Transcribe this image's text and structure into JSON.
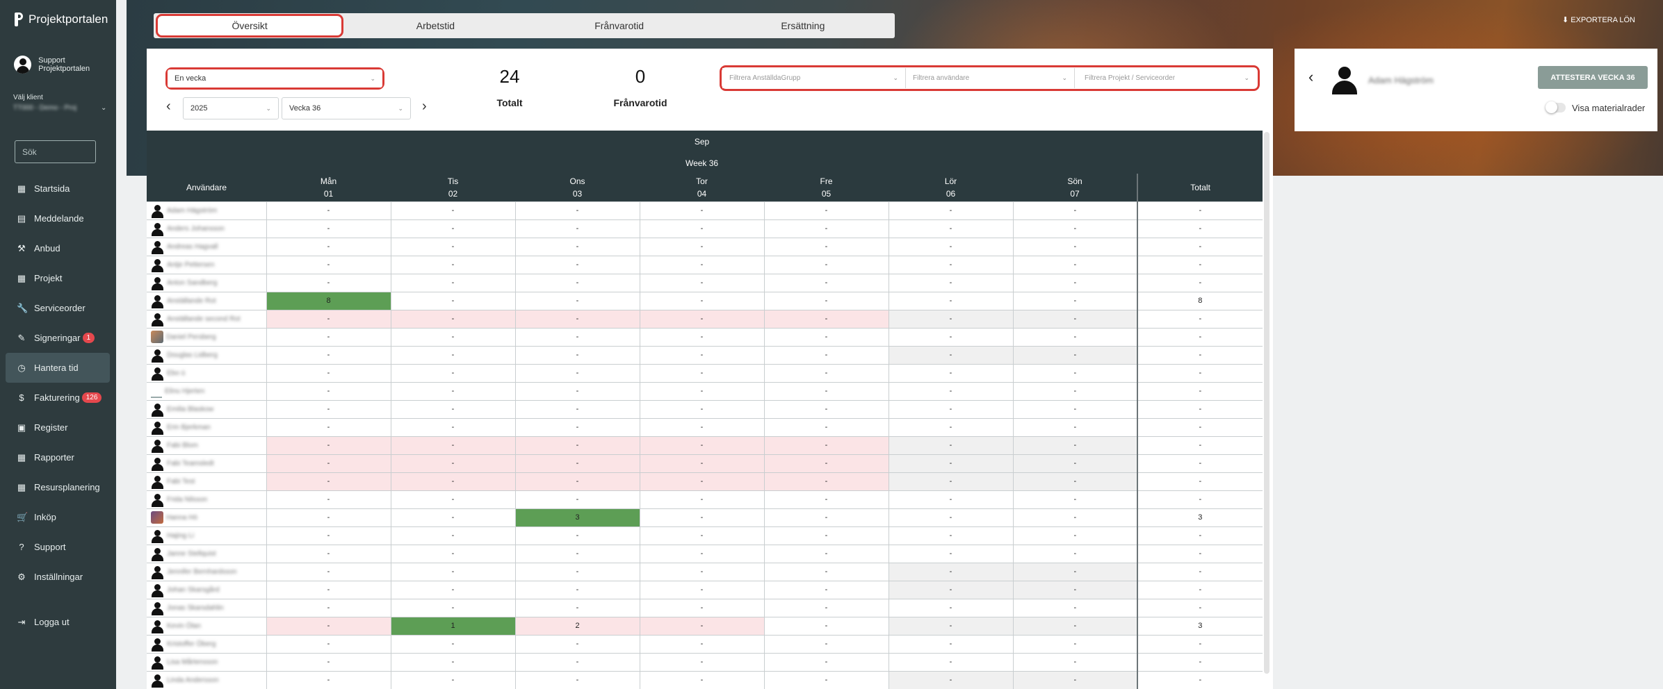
{
  "app": {
    "name": "Projektportalen"
  },
  "sidebar": {
    "user_name": "Support Projektportalen",
    "client_label": "Välj klient",
    "client_value": "TT000 - Demo - Proj",
    "search_placeholder": "Sök",
    "items": [
      {
        "label": "Startsida",
        "icon": "grid-icon",
        "glyph": "▦"
      },
      {
        "label": "Meddelande",
        "icon": "message-icon",
        "glyph": "▤"
      },
      {
        "label": "Anbud",
        "icon": "gavel-icon",
        "glyph": "⚒"
      },
      {
        "label": "Projekt",
        "icon": "project-icon",
        "glyph": "▦"
      },
      {
        "label": "Serviceorder",
        "icon": "wrench-icon",
        "glyph": "🔧"
      },
      {
        "label": "Signeringar",
        "icon": "signature-icon",
        "glyph": "✎",
        "badge": "1"
      },
      {
        "label": "Hantera tid",
        "icon": "clock-icon",
        "glyph": "◷",
        "active": true
      },
      {
        "label": "Fakturering",
        "icon": "dollar-icon",
        "glyph": "$",
        "badge": "126"
      },
      {
        "label": "Register",
        "icon": "register-icon",
        "glyph": "▣"
      },
      {
        "label": "Rapporter",
        "icon": "calendar-icon",
        "glyph": "▦"
      },
      {
        "label": "Resursplanering",
        "icon": "calendar-icon",
        "glyph": "▦"
      },
      {
        "label": "Inköp",
        "icon": "cart-icon",
        "glyph": "🛒"
      },
      {
        "label": "Support",
        "icon": "help-icon",
        "glyph": "?"
      },
      {
        "label": "Inställningar",
        "icon": "gear-icon",
        "glyph": "⚙"
      }
    ],
    "logout": "Logga ut"
  },
  "header": {
    "export_label": "EXPORTERA LÖN"
  },
  "tabs": [
    "Översikt",
    "Arbetstid",
    "Frånvarotid",
    "Ersättning"
  ],
  "controls": {
    "period": "En vecka",
    "year": "2025",
    "week": "Vecka 36",
    "filter_group": "Filtrera AnställdaGrupp",
    "filter_user": "Filtrera användare",
    "filter_project": "Filtrera Projekt / Serviceorder"
  },
  "stats": {
    "total_value": "24",
    "total_label": "Totalt",
    "absence_value": "0",
    "absence_label": "Frånvarotid"
  },
  "table": {
    "month": "Sep",
    "week_label": "Week 36",
    "user_header": "Användare",
    "total_header": "Totalt",
    "days": [
      {
        "name": "Mån",
        "num": "01",
        "weekend": false
      },
      {
        "name": "Tis",
        "num": "02",
        "weekend": false
      },
      {
        "name": "Ons",
        "num": "03",
        "weekend": false
      },
      {
        "name": "Tor",
        "num": "04",
        "weekend": false
      },
      {
        "name": "Fre",
        "num": "05",
        "weekend": false
      },
      {
        "name": "Lör",
        "num": "06",
        "weekend": true
      },
      {
        "name": "Sön",
        "num": "07",
        "weekend": true
      }
    ],
    "rows": [
      {
        "name": "Adam Hägström",
        "avatar": "person",
        "cells": [
          "-",
          "-",
          "-",
          "-",
          "-",
          "-",
          "-"
        ],
        "total": "-"
      },
      {
        "name": "Anders Johansson",
        "avatar": "person",
        "cells": [
          "-",
          "-",
          "-",
          "-",
          "-",
          "-",
          "-"
        ],
        "total": "-"
      },
      {
        "name": "Andreas Hagvall",
        "avatar": "person",
        "cells": [
          "-",
          "-",
          "-",
          "-",
          "-",
          "-",
          "-"
        ],
        "total": "-"
      },
      {
        "name": "Antje Pettersen",
        "avatar": "person",
        "cells": [
          "-",
          "-",
          "-",
          "-",
          "-",
          "-",
          "-"
        ],
        "total": "-"
      },
      {
        "name": "Anton Sandberg",
        "avatar": "person",
        "cells": [
          "-",
          "-",
          "-",
          "-",
          "-",
          "-",
          "-"
        ],
        "total": "-"
      },
      {
        "name": "Anställande Rot",
        "avatar": "person",
        "cells": [
          "8",
          "-",
          "-",
          "-",
          "-",
          "-",
          "-"
        ],
        "total": "8",
        "status": [
          "hours",
          "",
          "",
          "",
          "",
          "",
          ""
        ]
      },
      {
        "name": "Anställande second Rot",
        "avatar": "person",
        "cells": [
          "-",
          "-",
          "-",
          "-",
          "-",
          "-",
          "-"
        ],
        "total": "-",
        "status": [
          "absent",
          "absent",
          "absent",
          "absent",
          "absent",
          "wk",
          "wk"
        ]
      },
      {
        "name": "Daniel Persberg",
        "avatar": "photo",
        "cells": [
          "-",
          "-",
          "-",
          "-",
          "-",
          "-",
          "-"
        ],
        "total": "-"
      },
      {
        "name": "Douglas Lidberg",
        "avatar": "person",
        "cells": [
          "-",
          "-",
          "-",
          "-",
          "-",
          "-",
          "-"
        ],
        "total": "-",
        "status": [
          "",
          "",
          "",
          "",
          "",
          "wk",
          "wk"
        ]
      },
      {
        "name": "Ebo ü",
        "avatar": "person",
        "cells": [
          "-",
          "-",
          "-",
          "-",
          "-",
          "-",
          "-"
        ],
        "total": "-"
      },
      {
        "name": "Elinu Hjerten",
        "avatar": "doc",
        "cells": [
          "-",
          "-",
          "-",
          "-",
          "-",
          "-",
          "-"
        ],
        "total": "-"
      },
      {
        "name": "Emilia Blaskow",
        "avatar": "person",
        "cells": [
          "-",
          "-",
          "-",
          "-",
          "-",
          "-",
          "-"
        ],
        "total": "-"
      },
      {
        "name": "Erin Bjerkman",
        "avatar": "person",
        "cells": [
          "-",
          "-",
          "-",
          "-",
          "-",
          "-",
          "-"
        ],
        "total": "-"
      },
      {
        "name": "Fabi Blom",
        "avatar": "person",
        "cells": [
          "-",
          "-",
          "-",
          "-",
          "-",
          "-",
          "-"
        ],
        "total": "-",
        "status": [
          "absent",
          "absent",
          "absent",
          "absent",
          "absent",
          "wk",
          "wk"
        ]
      },
      {
        "name": "Fabi Teamsledt",
        "avatar": "person",
        "cells": [
          "-",
          "-",
          "-",
          "-",
          "-",
          "-",
          "-"
        ],
        "total": "-",
        "status": [
          "absent",
          "absent",
          "absent",
          "absent",
          "absent",
          "wk",
          "wk"
        ]
      },
      {
        "name": "Fabi Test",
        "avatar": "person",
        "cells": [
          "-",
          "-",
          "-",
          "-",
          "-",
          "-",
          "-"
        ],
        "total": "-",
        "status": [
          "absent",
          "absent",
          "absent",
          "absent",
          "absent",
          "wk",
          "wk"
        ]
      },
      {
        "name": "Frida Nilsson",
        "avatar": "person",
        "cells": [
          "-",
          "-",
          "-",
          "-",
          "-",
          "-",
          "-"
        ],
        "total": "-"
      },
      {
        "name": "Hanna Hö",
        "avatar": "photo2",
        "cells": [
          "-",
          "-",
          "3",
          "-",
          "-",
          "-",
          "-"
        ],
        "total": "3",
        "status": [
          "",
          "",
          "hours",
          "",
          "",
          "",
          ""
        ]
      },
      {
        "name": "Hajing Li",
        "avatar": "person",
        "cells": [
          "-",
          "-",
          "-",
          "-",
          "-",
          "-",
          "-"
        ],
        "total": "-"
      },
      {
        "name": "Janne Stellquist",
        "avatar": "person",
        "cells": [
          "-",
          "-",
          "-",
          "-",
          "-",
          "-",
          "-"
        ],
        "total": "-"
      },
      {
        "name": "Jennifer Bernhardsson",
        "avatar": "person",
        "cells": [
          "-",
          "-",
          "-",
          "-",
          "-",
          "-",
          "-"
        ],
        "total": "-",
        "status": [
          "",
          "",
          "",
          "",
          "",
          "wk",
          "wk"
        ]
      },
      {
        "name": "Johan Skarsgård",
        "avatar": "person",
        "cells": [
          "-",
          "-",
          "-",
          "-",
          "-",
          "-",
          "-"
        ],
        "total": "-",
        "status": [
          "",
          "",
          "",
          "",
          "",
          "wk",
          "wk"
        ]
      },
      {
        "name": "Jonas Skarsdahlin",
        "avatar": "person",
        "cells": [
          "-",
          "-",
          "-",
          "-",
          "-",
          "-",
          "-"
        ],
        "total": "-"
      },
      {
        "name": "Kevin Ölan",
        "avatar": "person",
        "cells": [
          "-",
          "1",
          "2",
          "-",
          "-",
          "-",
          "-"
        ],
        "total": "3",
        "status": [
          "absent",
          "hours",
          "absent",
          "absent",
          "",
          "wk",
          "wk"
        ]
      },
      {
        "name": "Kristoffer Öberg",
        "avatar": "person",
        "cells": [
          "-",
          "-",
          "-",
          "-",
          "-",
          "-",
          "-"
        ],
        "total": "-"
      },
      {
        "name": "Lisa Mårtensson",
        "avatar": "person",
        "cells": [
          "-",
          "-",
          "-",
          "-",
          "-",
          "-",
          "-"
        ],
        "total": "-"
      },
      {
        "name": "Linda Andersson",
        "avatar": "person",
        "cells": [
          "-",
          "-",
          "-",
          "-",
          "-",
          "-",
          "-"
        ],
        "total": "-",
        "status": [
          "",
          "",
          "",
          "",
          "",
          "wk",
          "wk"
        ]
      }
    ]
  },
  "right_panel": {
    "user_name": "Adam Hägström",
    "attest_button": "ATTESTERA VECKA 36",
    "toggle_label": "Visa materialrader",
    "toggle_on": false
  }
}
